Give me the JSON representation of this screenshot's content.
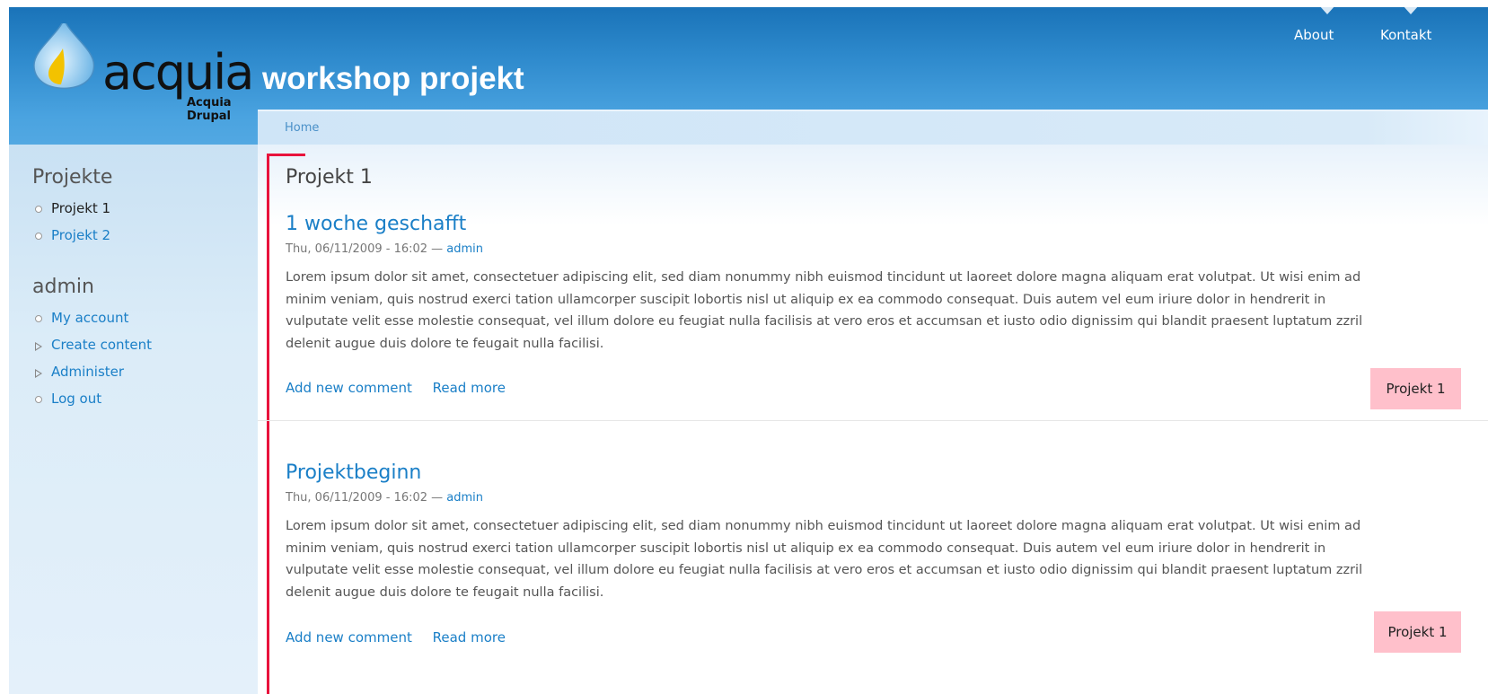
{
  "site": {
    "name": "workshop projekt",
    "logo_word": "acquia",
    "logo_sub": "Acquia Drupal"
  },
  "primary_nav": [
    {
      "label": "About"
    },
    {
      "label": "Kontakt"
    }
  ],
  "breadcrumb": {
    "home": "Home"
  },
  "sidebar": {
    "projekte": {
      "title": "Projekte",
      "items": [
        {
          "label": "Projekt 1"
        },
        {
          "label": "Projekt 2"
        }
      ]
    },
    "user": {
      "title": "admin",
      "items": [
        {
          "label": "My account"
        },
        {
          "label": "Create content"
        },
        {
          "label": "Administer"
        },
        {
          "label": "Log out"
        }
      ]
    }
  },
  "main": {
    "page_title": "Projekt 1",
    "nodes": [
      {
        "title": "1 woche geschafft",
        "date": "Thu, 06/11/2009 - 16:02",
        "sep": " — ",
        "author": "admin",
        "body": "Lorem ipsum dolor sit amet, consectetuer adipiscing elit, sed diam nonummy nibh euismod tincidunt ut laoreet dolore magna aliquam erat volutpat. Ut wisi enim ad minim veniam, quis nostrud exerci tation ullamcorper suscipit lobortis nisl ut aliquip ex ea commodo consequat. Duis autem vel eum iriure dolor in hendrerit in vulputate velit esse molestie consequat, vel illum dolore eu feugiat nulla facilisis at vero eros et accumsan et iusto odio dignissim qui blandit praesent luptatum zzril delenit augue duis dolore te feugait nulla facilisi.",
        "comment_link": "Add new comment",
        "read_more": "Read more",
        "tag": "Projekt 1"
      },
      {
        "title": "Projektbeginn",
        "date": "Thu, 06/11/2009 - 16:02",
        "sep": " — ",
        "author": "admin",
        "body": "Lorem ipsum dolor sit amet, consectetuer adipiscing elit, sed diam nonummy nibh euismod tincidunt ut laoreet dolore magna aliquam erat volutpat. Ut wisi enim ad minim veniam, quis nostrud exerci tation ullamcorper suscipit lobortis nisl ut aliquip ex ea commodo consequat. Duis autem vel eum iriure dolor in hendrerit in vulputate velit esse molestie consequat, vel illum dolore eu feugiat nulla facilisis at vero eros et accumsan et iusto odio dignissim qui blandit praesent luptatum zzril delenit augue duis dolore te feugait nulla facilisi.",
        "comment_link": "Add new comment",
        "read_more": "Read more",
        "tag": "Projekt 1"
      }
    ]
  },
  "colors": {
    "header_blue": "#2d89cc",
    "link": "#1a7fc7",
    "highlight_red": "#e8133c",
    "tag_pink": "#ffc0cb"
  },
  "icons": {
    "logo": "water-drop-icon",
    "list_bullet": "circle-bullet-icon",
    "collapsed_bullet": "triangle-bullet-icon"
  }
}
